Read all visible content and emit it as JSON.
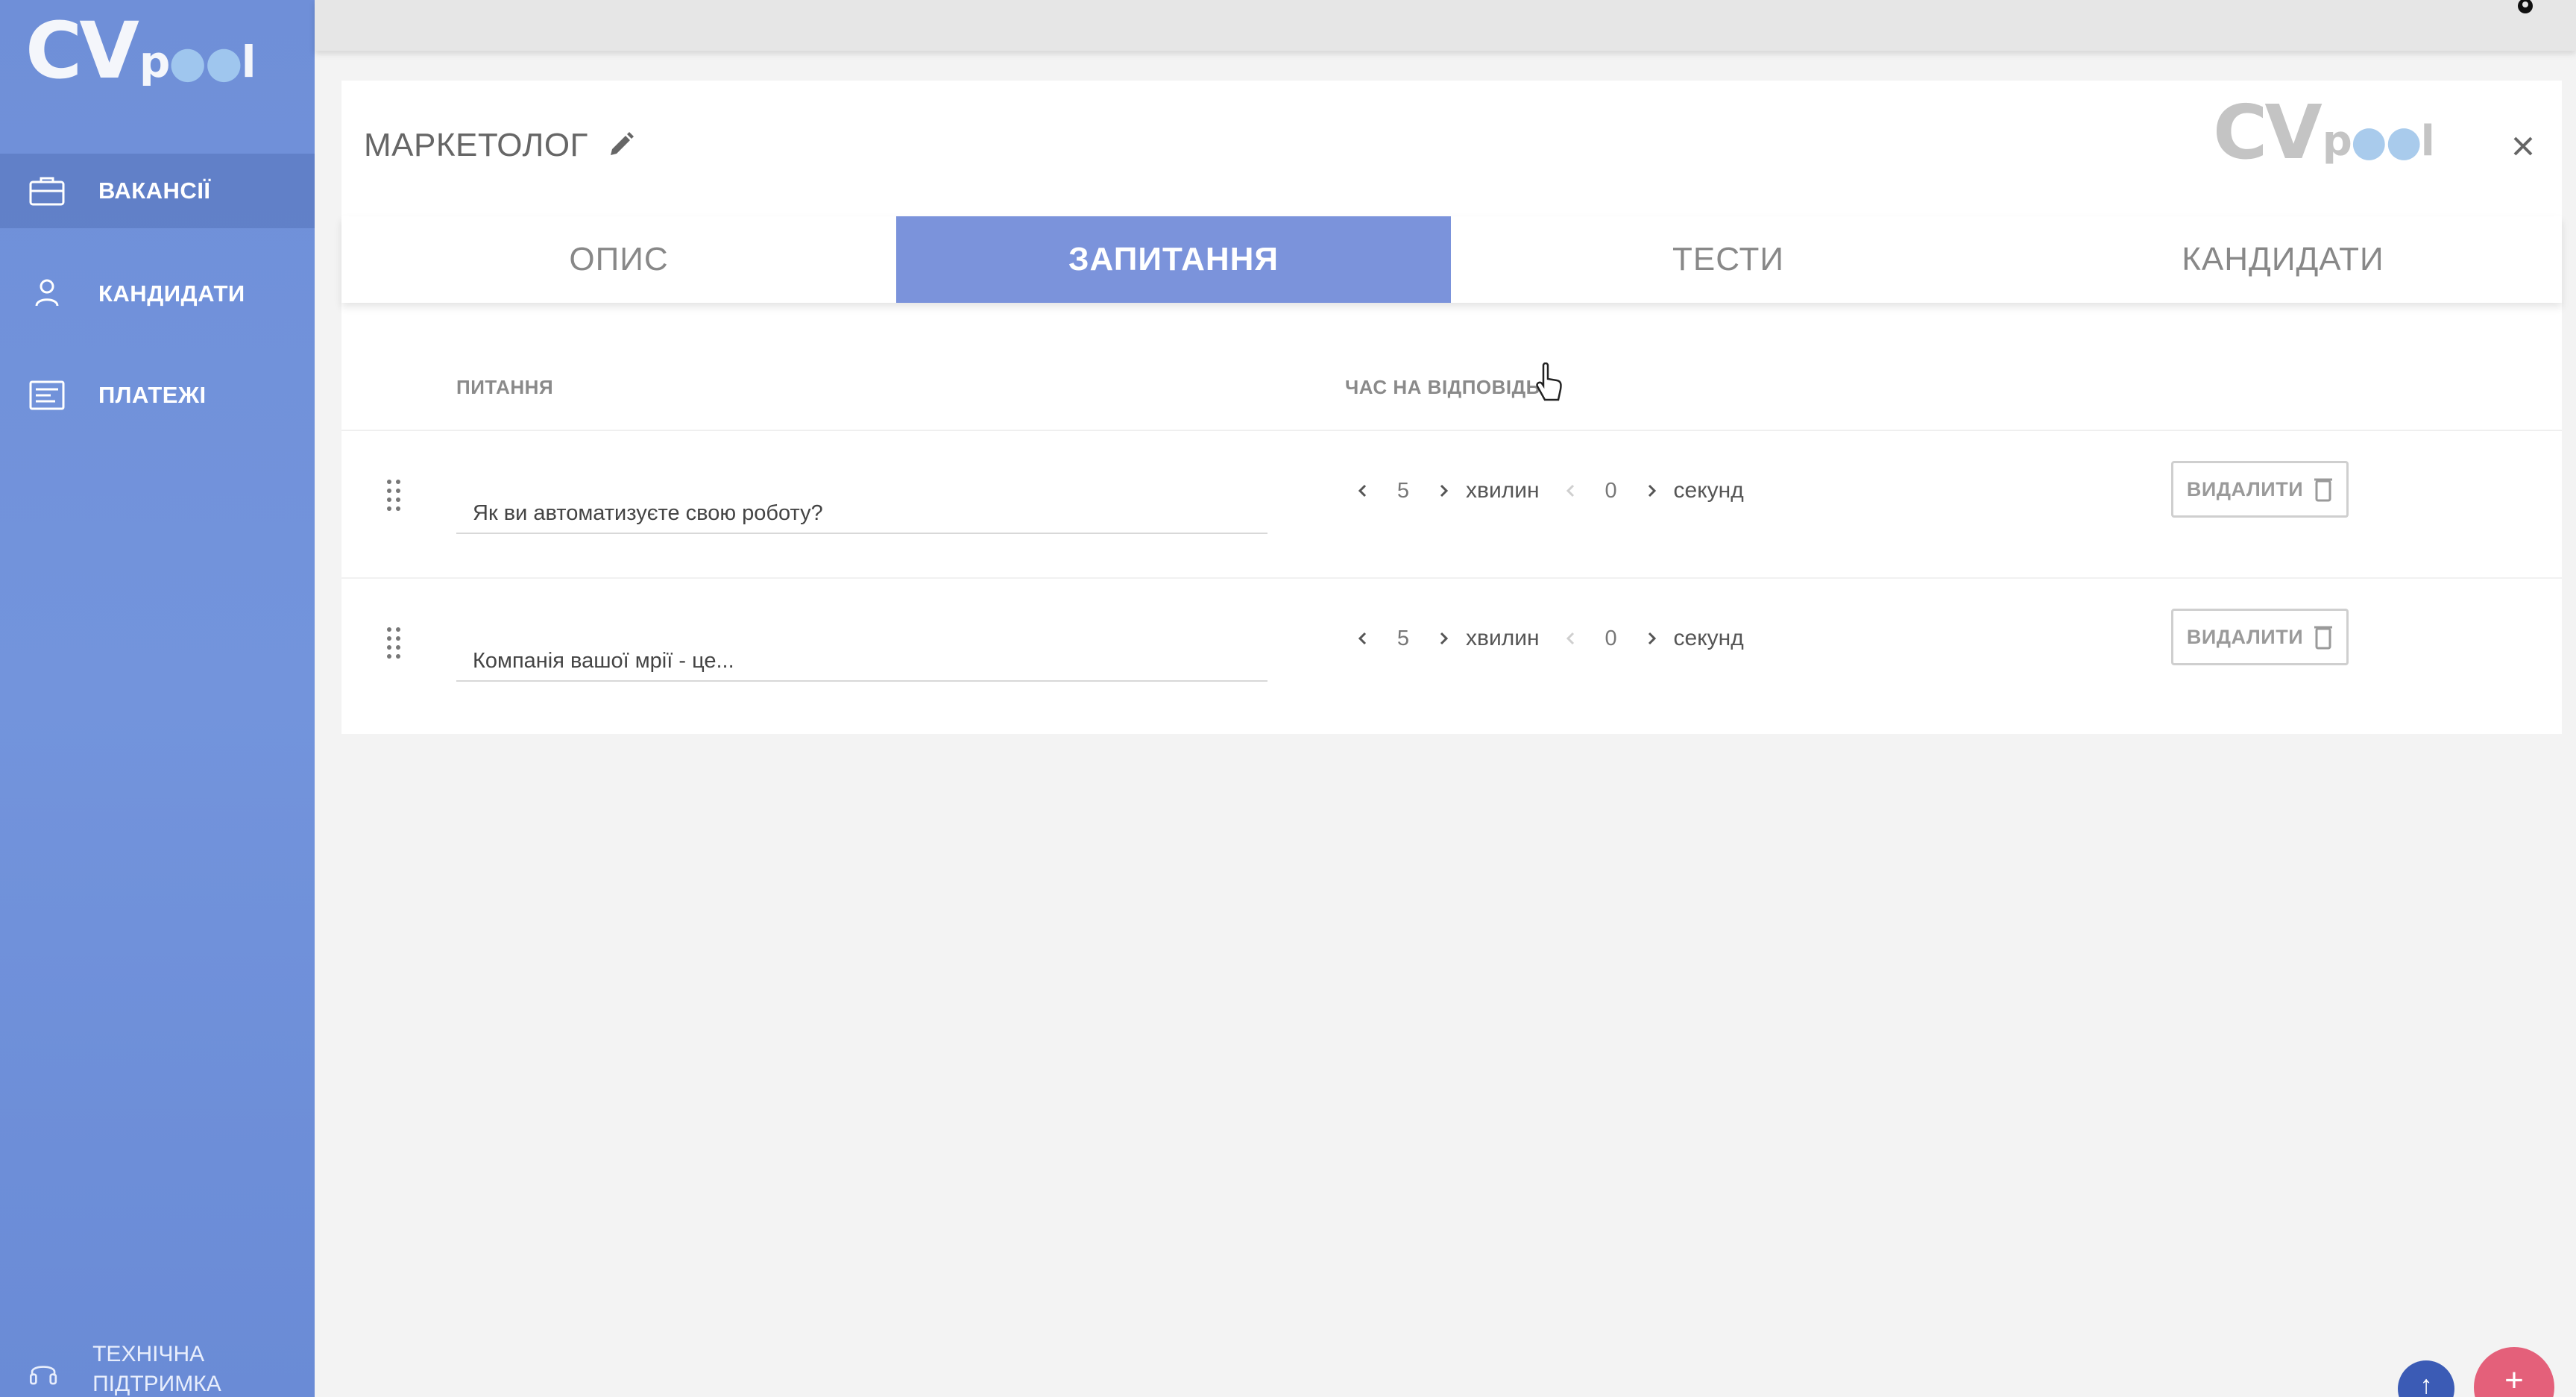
{
  "app": {
    "logo_main": "CV",
    "logo_suffix": "pool"
  },
  "sidebar": {
    "items": [
      {
        "label": "ВАКАНСІЇ",
        "icon": "briefcase-icon",
        "active": true
      },
      {
        "label": "КАНДИДАТИ",
        "icon": "person-icon",
        "active": false
      },
      {
        "label": "ПЛАТЕЖІ",
        "icon": "receipt-icon",
        "active": false
      }
    ],
    "support_label": "ТЕХНІЧНА ПІДТРИМКА",
    "support_icon": "headset-icon"
  },
  "vacancy": {
    "title": "МАРКЕТОЛОГ",
    "brand_main": "CV",
    "brand_suffix": "pool"
  },
  "tabs": [
    {
      "label": "ОПИС",
      "active": false
    },
    {
      "label": "ЗАПИТАННЯ",
      "active": true
    },
    {
      "label": "ТЕСТИ",
      "active": false
    },
    {
      "label": "КАНДИДАТИ",
      "active": false
    }
  ],
  "questions_table": {
    "headers": {
      "question": "ПИТАННЯ",
      "time": "ЧАС НА ВІДПОВІДЬ"
    },
    "rows": [
      {
        "question": "Як ви автоматизуєте свою роботу?",
        "minutes": "5",
        "minutes_unit": "хвилин",
        "seconds": "0",
        "seconds_unit": "секунд",
        "delete_label": "ВИДАЛИТИ"
      },
      {
        "question": "Компанія вашої мрії - це...",
        "minutes": "5",
        "minutes_unit": "хвилин",
        "seconds": "0",
        "seconds_unit": "секунд",
        "delete_label": "ВИДАЛИТИ"
      }
    ]
  },
  "colors": {
    "sidebar": "#7394dc",
    "active_tab": "#7b93db",
    "fab_blue": "#3b5bb5",
    "fab_red": "#e4607a"
  }
}
